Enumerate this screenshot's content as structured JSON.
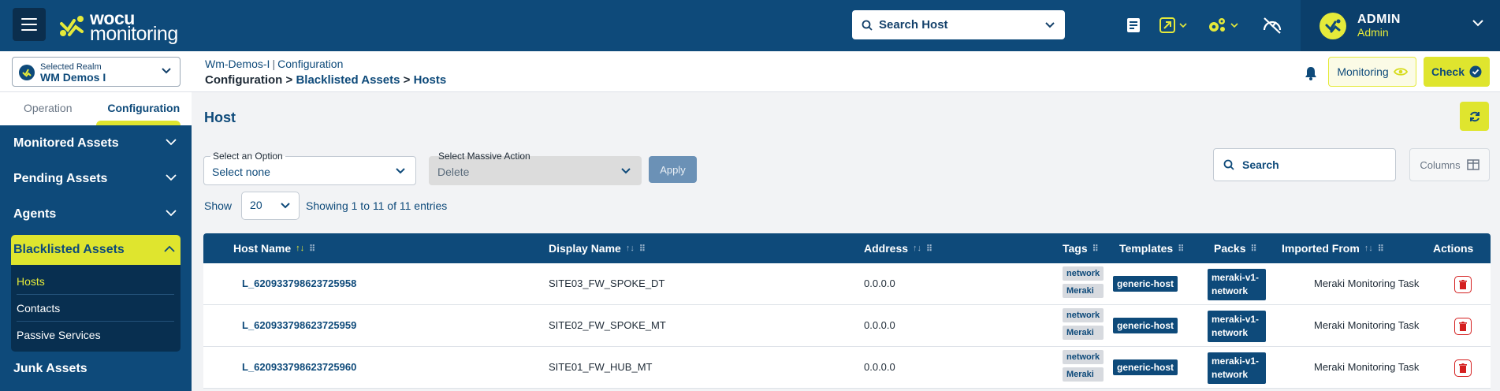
{
  "header": {
    "logo_line1": "wocu",
    "logo_line2": "monitoring",
    "search_host_placeholder": "Search Host",
    "admin_name": "ADMIN",
    "admin_role": "Admin"
  },
  "realm": {
    "label": "Selected Realm",
    "value": "WM Demos I"
  },
  "breadcrumb": {
    "top_realm": "Wm-Demos-I",
    "top_separator": "|",
    "top_section": "Configuration",
    "root": "Configuration",
    "sep": ">",
    "level1": "Blacklisted Assets",
    "level2": "Hosts"
  },
  "actions": {
    "monitoring_label": "Monitoring",
    "check_label": "Check"
  },
  "sidebar": {
    "tabs": [
      {
        "label": "Operation"
      },
      {
        "label": "Configuration"
      }
    ],
    "items": [
      {
        "label": "Monitored Assets"
      },
      {
        "label": "Pending Assets"
      },
      {
        "label": "Agents"
      },
      {
        "label": "Blacklisted Assets"
      },
      {
        "label": "Junk Assets"
      }
    ],
    "submenu": [
      {
        "label": "Hosts"
      },
      {
        "label": "Contacts"
      },
      {
        "label": "Passive Services"
      }
    ]
  },
  "main": {
    "title": "Host",
    "option_select": {
      "label": "Select an Option",
      "value": "Select none"
    },
    "massive_select": {
      "label": "Select Massive Action",
      "value": "Delete"
    },
    "apply_label": "Apply",
    "search_placeholder": "Search",
    "columns_label": "Columns",
    "show_label": "Show",
    "page_size": "20",
    "entries_text": "Showing 1 to 11 of 11 entries"
  },
  "table": {
    "columns": [
      "Host Name",
      "Display Name",
      "Address",
      "Tags",
      "Templates",
      "Packs",
      "Imported From",
      "Actions"
    ],
    "rows": [
      {
        "host": "L_620933798623725958",
        "display": "SITE03_FW_SPOKE_DT",
        "address": "0.0.0.0",
        "tags": [
          "network",
          "Meraki"
        ],
        "template": "generic-host",
        "pack_line1": "meraki-v1-",
        "pack_line2": "network",
        "imported": "Meraki Monitoring Task"
      },
      {
        "host": "L_620933798623725959",
        "display": "SITE02_FW_SPOKE_MT",
        "address": "0.0.0.0",
        "tags": [
          "network",
          "Meraki"
        ],
        "template": "generic-host",
        "pack_line1": "meraki-v1-",
        "pack_line2": "network",
        "imported": "Meraki Monitoring Task"
      },
      {
        "host": "L_620933798623725960",
        "display": "SITE01_FW_HUB_MT",
        "address": "0.0.0.0",
        "tags": [
          "network",
          "Meraki"
        ],
        "template": "generic-host",
        "pack_line1": "meraki-v1-",
        "pack_line2": "network",
        "imported": "Meraki Monitoring Task"
      }
    ]
  },
  "colors": {
    "primary": "#0e4a7a",
    "accent": "#dfe52e",
    "danger": "#d42020"
  }
}
